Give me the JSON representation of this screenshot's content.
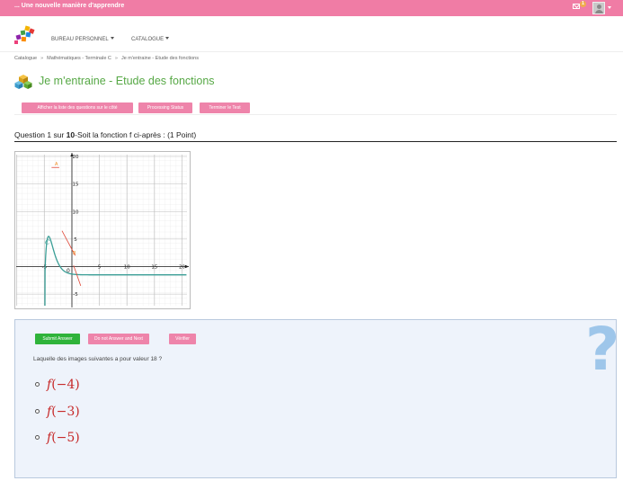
{
  "topbar": {
    "brand": "... Une nouvelle manière d'apprendre",
    "mail_icon": "envelope-icon",
    "notification_count": "1",
    "avatar_icon": "user-avatar-icon"
  },
  "nav": {
    "items": [
      {
        "label": "BUREAU PERSONNEL"
      },
      {
        "label": "CATALOGUE"
      }
    ]
  },
  "breadcrumb": [
    "Catalogue",
    "Mathématiques - Terminale C",
    "Je m'entraine - Etude des fonctions"
  ],
  "page": {
    "title": "Je m'entraine - Etude des fonctions",
    "title_icon": "cubes-icon"
  },
  "toolbar": {
    "show_questions": "Afficher la liste des questions sur le côté",
    "processing_status": "Processing Status",
    "finish_test": "Terminer le Test"
  },
  "question": {
    "prefix": "Question 1 sur ",
    "total": "10",
    "text": "-Soit la fonction f ci-après : (1 Point)"
  },
  "graph": {
    "x_ticks": [
      "-5",
      "5",
      "10",
      "15",
      "20"
    ],
    "y_ticks": [
      "20",
      "15",
      "10",
      "5",
      "-5"
    ],
    "origin_label": "0",
    "curve_label": "C",
    "point_labels": [
      "A",
      "B"
    ],
    "colors": {
      "curve": "#3a9e96",
      "tangent": "#e04a3a",
      "points": "#f08a1c"
    }
  },
  "answer_panel": {
    "submit": "Submit Answer",
    "skip": "Do not Answer and Next",
    "verify": "Vérifier",
    "help_icon": "question-mark-icon",
    "prompt": "Laquelle des images suivantes a pour valeur 18 ?",
    "options": [
      {
        "func": "f",
        "arg": "(−4)"
      },
      {
        "func": "f",
        "arg": "(−3)"
      },
      {
        "func": "f",
        "arg": "(−5)"
      }
    ]
  }
}
